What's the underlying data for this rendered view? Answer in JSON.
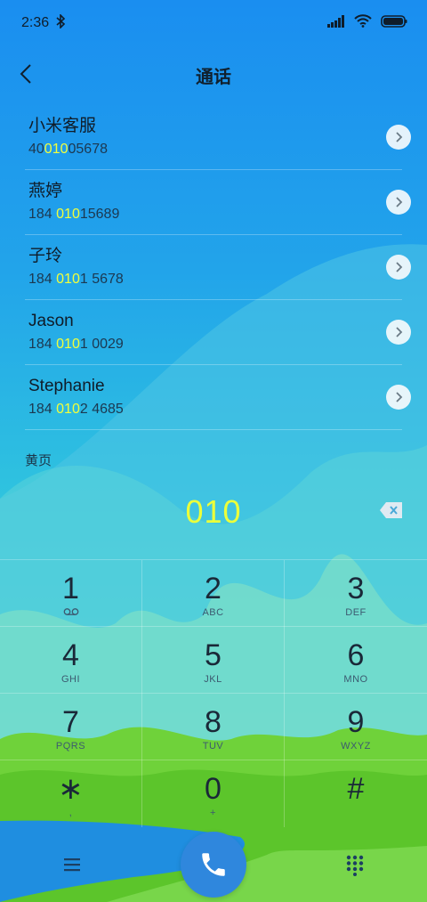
{
  "status_bar": {
    "time": "2:36"
  },
  "header": {
    "title": "通话"
  },
  "contacts": [
    {
      "name": "小米客服",
      "num_pre": "40",
      "num_hl": "010",
      "num_post": "05678"
    },
    {
      "name": "燕婷",
      "num_pre": "184 ",
      "num_hl": "010",
      "num_post": "15689"
    },
    {
      "name": "子玲",
      "num_pre": "184 ",
      "num_hl": "010",
      "num_post": "1 5678"
    },
    {
      "name": "Jason",
      "num_pre": "184 ",
      "num_hl": "010",
      "num_post": "1 0029"
    },
    {
      "name": "Stephanie",
      "num_pre": "184 ",
      "num_hl": "010",
      "num_post": "2 4685"
    }
  ],
  "section_label": "黄页",
  "dialed_number": "010",
  "keypad": [
    [
      {
        "digit": "1",
        "sub": ""
      },
      {
        "digit": "2",
        "sub": "ABC"
      },
      {
        "digit": "3",
        "sub": "DEF"
      }
    ],
    [
      {
        "digit": "4",
        "sub": "GHI"
      },
      {
        "digit": "5",
        "sub": "JKL"
      },
      {
        "digit": "6",
        "sub": "MNO"
      }
    ],
    [
      {
        "digit": "7",
        "sub": "PQRS"
      },
      {
        "digit": "8",
        "sub": "TUV"
      },
      {
        "digit": "9",
        "sub": "WXYZ"
      }
    ],
    [
      {
        "digit": "∗",
        "sub": ","
      },
      {
        "digit": "0",
        "sub": "+"
      },
      {
        "digit": "#",
        "sub": ""
      }
    ]
  ],
  "icons": {
    "bluetooth": "bluetooth-icon",
    "signal": "signal-icon",
    "wifi": "wifi-icon",
    "battery": "battery-icon",
    "back": "back-arrow-icon",
    "chevron": "chevron-right-icon",
    "voicemail": "voicemail-icon",
    "delete": "backspace-icon",
    "menu": "menu-icon",
    "call": "phone-icon",
    "keypad": "dialpad-icon"
  },
  "colors": {
    "highlight": "#f2ff3a",
    "call_button": "#2f87dd"
  }
}
